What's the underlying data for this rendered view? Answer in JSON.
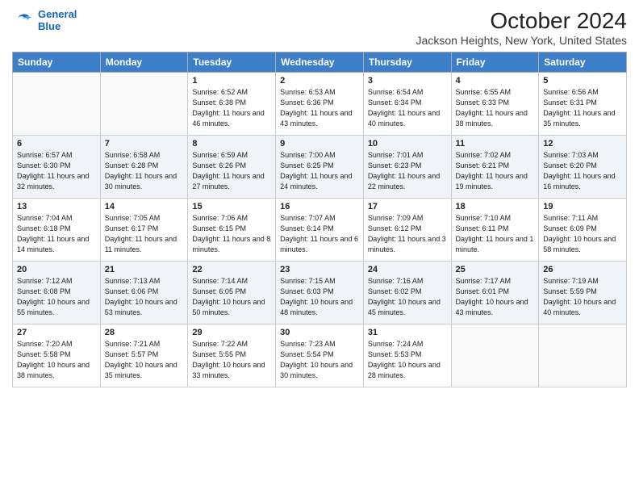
{
  "logo": {
    "line1": "General",
    "line2": "Blue"
  },
  "title": "October 2024",
  "subtitle": "Jackson Heights, New York, United States",
  "days_of_week": [
    "Sunday",
    "Monday",
    "Tuesday",
    "Wednesday",
    "Thursday",
    "Friday",
    "Saturday"
  ],
  "weeks": [
    [
      {
        "num": "",
        "sunrise": "",
        "sunset": "",
        "daylight": ""
      },
      {
        "num": "",
        "sunrise": "",
        "sunset": "",
        "daylight": ""
      },
      {
        "num": "1",
        "sunrise": "Sunrise: 6:52 AM",
        "sunset": "Sunset: 6:38 PM",
        "daylight": "Daylight: 11 hours and 46 minutes."
      },
      {
        "num": "2",
        "sunrise": "Sunrise: 6:53 AM",
        "sunset": "Sunset: 6:36 PM",
        "daylight": "Daylight: 11 hours and 43 minutes."
      },
      {
        "num": "3",
        "sunrise": "Sunrise: 6:54 AM",
        "sunset": "Sunset: 6:34 PM",
        "daylight": "Daylight: 11 hours and 40 minutes."
      },
      {
        "num": "4",
        "sunrise": "Sunrise: 6:55 AM",
        "sunset": "Sunset: 6:33 PM",
        "daylight": "Daylight: 11 hours and 38 minutes."
      },
      {
        "num": "5",
        "sunrise": "Sunrise: 6:56 AM",
        "sunset": "Sunset: 6:31 PM",
        "daylight": "Daylight: 11 hours and 35 minutes."
      }
    ],
    [
      {
        "num": "6",
        "sunrise": "Sunrise: 6:57 AM",
        "sunset": "Sunset: 6:30 PM",
        "daylight": "Daylight: 11 hours and 32 minutes."
      },
      {
        "num": "7",
        "sunrise": "Sunrise: 6:58 AM",
        "sunset": "Sunset: 6:28 PM",
        "daylight": "Daylight: 11 hours and 30 minutes."
      },
      {
        "num": "8",
        "sunrise": "Sunrise: 6:59 AM",
        "sunset": "Sunset: 6:26 PM",
        "daylight": "Daylight: 11 hours and 27 minutes."
      },
      {
        "num": "9",
        "sunrise": "Sunrise: 7:00 AM",
        "sunset": "Sunset: 6:25 PM",
        "daylight": "Daylight: 11 hours and 24 minutes."
      },
      {
        "num": "10",
        "sunrise": "Sunrise: 7:01 AM",
        "sunset": "Sunset: 6:23 PM",
        "daylight": "Daylight: 11 hours and 22 minutes."
      },
      {
        "num": "11",
        "sunrise": "Sunrise: 7:02 AM",
        "sunset": "Sunset: 6:21 PM",
        "daylight": "Daylight: 11 hours and 19 minutes."
      },
      {
        "num": "12",
        "sunrise": "Sunrise: 7:03 AM",
        "sunset": "Sunset: 6:20 PM",
        "daylight": "Daylight: 11 hours and 16 minutes."
      }
    ],
    [
      {
        "num": "13",
        "sunrise": "Sunrise: 7:04 AM",
        "sunset": "Sunset: 6:18 PM",
        "daylight": "Daylight: 11 hours and 14 minutes."
      },
      {
        "num": "14",
        "sunrise": "Sunrise: 7:05 AM",
        "sunset": "Sunset: 6:17 PM",
        "daylight": "Daylight: 11 hours and 11 minutes."
      },
      {
        "num": "15",
        "sunrise": "Sunrise: 7:06 AM",
        "sunset": "Sunset: 6:15 PM",
        "daylight": "Daylight: 11 hours and 8 minutes."
      },
      {
        "num": "16",
        "sunrise": "Sunrise: 7:07 AM",
        "sunset": "Sunset: 6:14 PM",
        "daylight": "Daylight: 11 hours and 6 minutes."
      },
      {
        "num": "17",
        "sunrise": "Sunrise: 7:09 AM",
        "sunset": "Sunset: 6:12 PM",
        "daylight": "Daylight: 11 hours and 3 minutes."
      },
      {
        "num": "18",
        "sunrise": "Sunrise: 7:10 AM",
        "sunset": "Sunset: 6:11 PM",
        "daylight": "Daylight: 11 hours and 1 minute."
      },
      {
        "num": "19",
        "sunrise": "Sunrise: 7:11 AM",
        "sunset": "Sunset: 6:09 PM",
        "daylight": "Daylight: 10 hours and 58 minutes."
      }
    ],
    [
      {
        "num": "20",
        "sunrise": "Sunrise: 7:12 AM",
        "sunset": "Sunset: 6:08 PM",
        "daylight": "Daylight: 10 hours and 55 minutes."
      },
      {
        "num": "21",
        "sunrise": "Sunrise: 7:13 AM",
        "sunset": "Sunset: 6:06 PM",
        "daylight": "Daylight: 10 hours and 53 minutes."
      },
      {
        "num": "22",
        "sunrise": "Sunrise: 7:14 AM",
        "sunset": "Sunset: 6:05 PM",
        "daylight": "Daylight: 10 hours and 50 minutes."
      },
      {
        "num": "23",
        "sunrise": "Sunrise: 7:15 AM",
        "sunset": "Sunset: 6:03 PM",
        "daylight": "Daylight: 10 hours and 48 minutes."
      },
      {
        "num": "24",
        "sunrise": "Sunrise: 7:16 AM",
        "sunset": "Sunset: 6:02 PM",
        "daylight": "Daylight: 10 hours and 45 minutes."
      },
      {
        "num": "25",
        "sunrise": "Sunrise: 7:17 AM",
        "sunset": "Sunset: 6:01 PM",
        "daylight": "Daylight: 10 hours and 43 minutes."
      },
      {
        "num": "26",
        "sunrise": "Sunrise: 7:19 AM",
        "sunset": "Sunset: 5:59 PM",
        "daylight": "Daylight: 10 hours and 40 minutes."
      }
    ],
    [
      {
        "num": "27",
        "sunrise": "Sunrise: 7:20 AM",
        "sunset": "Sunset: 5:58 PM",
        "daylight": "Daylight: 10 hours and 38 minutes."
      },
      {
        "num": "28",
        "sunrise": "Sunrise: 7:21 AM",
        "sunset": "Sunset: 5:57 PM",
        "daylight": "Daylight: 10 hours and 35 minutes."
      },
      {
        "num": "29",
        "sunrise": "Sunrise: 7:22 AM",
        "sunset": "Sunset: 5:55 PM",
        "daylight": "Daylight: 10 hours and 33 minutes."
      },
      {
        "num": "30",
        "sunrise": "Sunrise: 7:23 AM",
        "sunset": "Sunset: 5:54 PM",
        "daylight": "Daylight: 10 hours and 30 minutes."
      },
      {
        "num": "31",
        "sunrise": "Sunrise: 7:24 AM",
        "sunset": "Sunset: 5:53 PM",
        "daylight": "Daylight: 10 hours and 28 minutes."
      },
      {
        "num": "",
        "sunrise": "",
        "sunset": "",
        "daylight": ""
      },
      {
        "num": "",
        "sunrise": "",
        "sunset": "",
        "daylight": ""
      }
    ]
  ]
}
